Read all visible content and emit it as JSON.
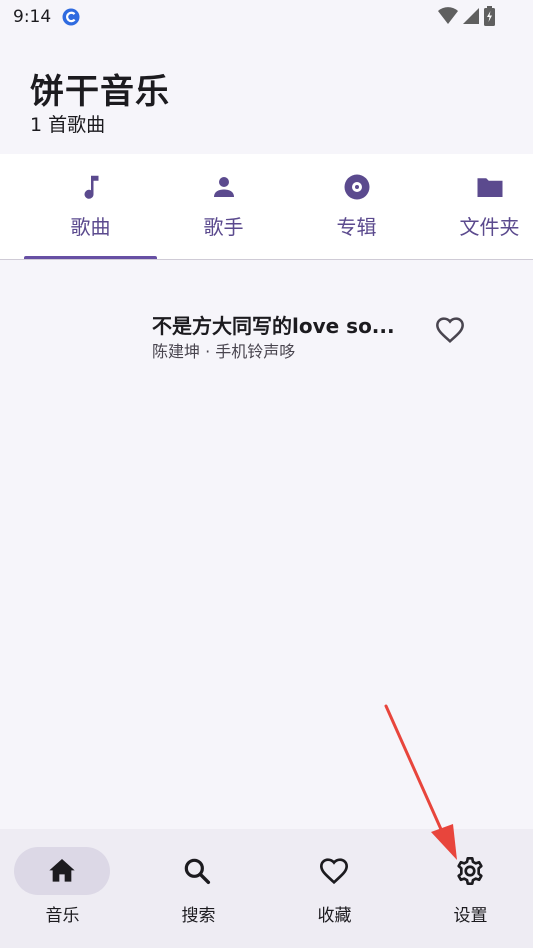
{
  "status_bar": {
    "time": "9:14"
  },
  "header": {
    "title": "饼干音乐",
    "subtitle": "1 首歌曲"
  },
  "tabs": [
    {
      "label": "歌曲",
      "icon": "music-note-icon",
      "selected": true
    },
    {
      "label": "歌手",
      "icon": "person-icon",
      "selected": false
    },
    {
      "label": "专辑",
      "icon": "album-disc-icon",
      "selected": false
    },
    {
      "label": "文件夹",
      "icon": "folder-icon",
      "selected": false
    }
  ],
  "songs": [
    {
      "title": "不是方大同写的love so...",
      "subtitle": "陈建坤 · 手机铃声哆",
      "favorite_icon": "heart-outline-icon"
    }
  ],
  "bottom_nav": [
    {
      "label": "音乐",
      "icon": "home-icon",
      "selected": true
    },
    {
      "label": "搜索",
      "icon": "search-icon",
      "selected": false
    },
    {
      "label": "收藏",
      "icon": "heart-outline-icon",
      "selected": false
    },
    {
      "label": "设置",
      "icon": "gear-icon",
      "selected": false
    }
  ],
  "colors": {
    "accent": "#6750a4",
    "arrow": "#e8453c",
    "background": "#f6f5fa"
  }
}
